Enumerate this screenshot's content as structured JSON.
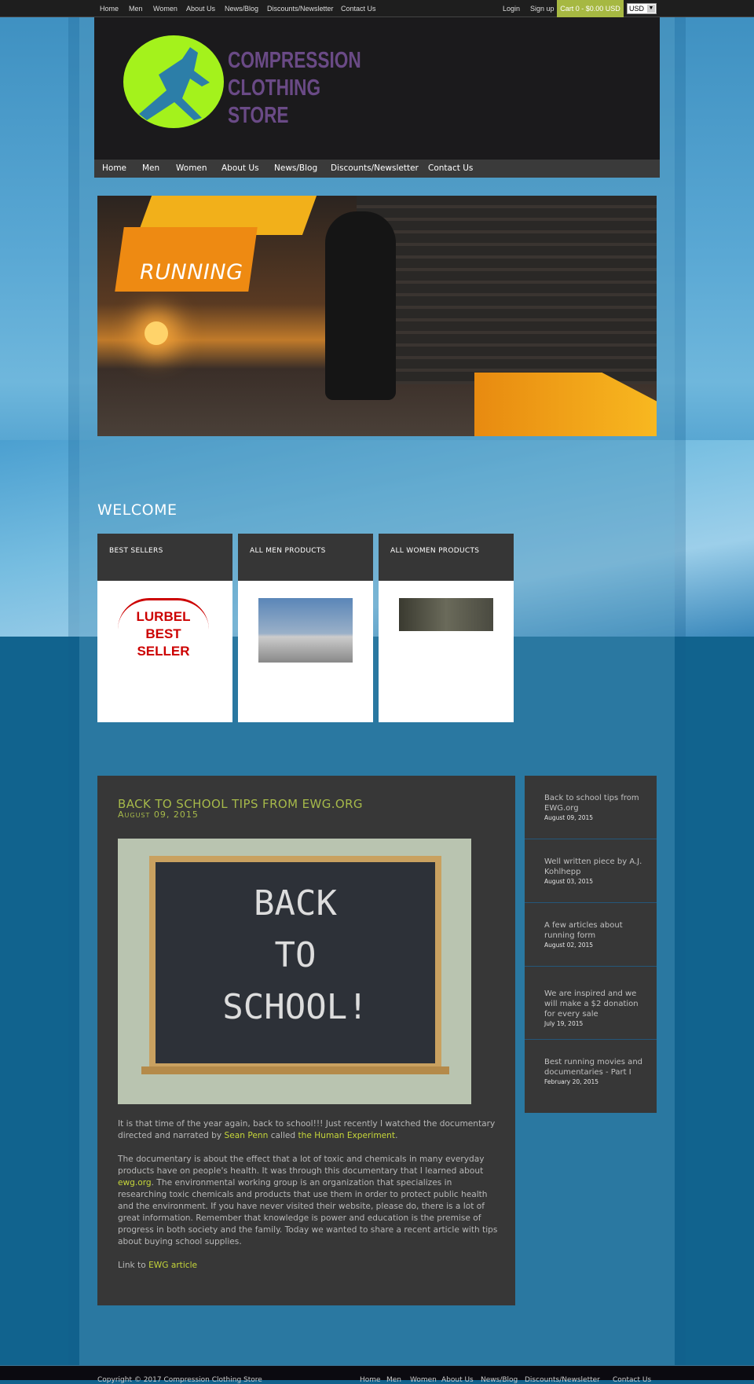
{
  "topbar": {
    "nav": [
      "Home",
      "Men",
      "Women",
      "About Us",
      "News/Blog",
      "Discounts/Newsletter",
      "Contact Us"
    ],
    "login": "Login",
    "signup": "Sign up",
    "cart": "Cart 0 - $0.00 USD",
    "currency": "USD"
  },
  "logo": {
    "text": "COMPRESSION CLOTHING STORE"
  },
  "nav": [
    "Home",
    "Men",
    "Women",
    "About Us",
    "News/Blog",
    "Discounts/Newsletter",
    "Contact Us"
  ],
  "hero": {
    "label": "RUNNING"
  },
  "welcome": "WELCOME",
  "cards": [
    {
      "title": "BEST SELLERS",
      "image": "LURBEL BEST SELLER"
    },
    {
      "title": "ALL MEN PRODUCTS"
    },
    {
      "title": "ALL WOMEN PRODUCTS"
    }
  ],
  "post": {
    "title": "BACK TO SCHOOL TIPS FROM EWG.ORG",
    "date": "August 09, 2015",
    "image_text": "BACK TO SCHOOL!",
    "p1_a": "It is that time of the year again, back to school!!! Just recently I watched the documentary directed and narrated by ",
    "p1_link1": "Sean Penn",
    "p1_b": " called ",
    "p1_link2": "the Human Experiment",
    "p2_link": "ewg.org",
    "p2_pre": "The documentary is about the effect that a lot of toxic and chemicals in many everyday products have on people's health. It was through this documentary that I learned about ",
    "p2_post": ". The environmental working group is an organization that specializes in researching toxic chemicals and products that use them in order to protect public health and the environment. If you have never visited their website, please do, there is a lot of great information. Remember that knowledge is power and education is the premise of progress in both society and the family. Today we wanted to share a recent article with tips about buying school supplies.",
    "p3_pre": "Link to ",
    "p3_link": "EWG article"
  },
  "sidebar": [
    {
      "title": "Back to school tips from EWG.org",
      "date": "August 09, 2015"
    },
    {
      "title": "Well written piece by A.J. Kohlhepp",
      "date": "August 03, 2015"
    },
    {
      "title": "A few articles about running form",
      "date": "August 02, 2015"
    },
    {
      "title": "We are inspired and we will make a $2 donation for every sale",
      "date": "July 19, 2015"
    },
    {
      "title": "Best running movies and documentaries - Part I",
      "date": "February 20, 2015"
    }
  ],
  "footer": {
    "copyright": "Copyright © 2017 Compression Clothing Store",
    "nav": [
      "Home",
      "Men",
      "Women",
      "About Us",
      "News/Blog",
      "Discounts/Newsletter",
      "Contact Us"
    ]
  },
  "colors": {
    "accent": "#a6b94a",
    "cart": "#a6b842",
    "link": "#c6d63a",
    "logo_green": "#a4f21c",
    "logo_purple": "#6a4a86"
  }
}
